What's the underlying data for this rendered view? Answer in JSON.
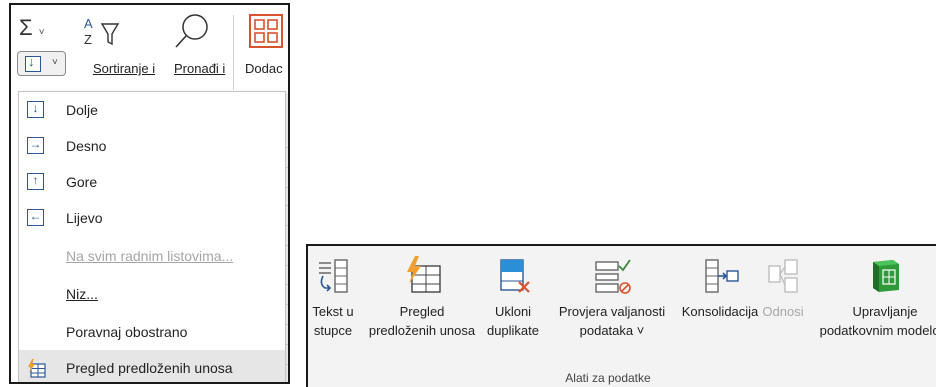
{
  "ribbon_top": {
    "sigma": "Σ",
    "sort_label": "Sortiranje i",
    "find_label": "Pronađi i",
    "add_label": "Dodac",
    "partial_text": "c"
  },
  "fill_menu": {
    "items": [
      {
        "label": "Dolje",
        "icon": "arrow-down-icon",
        "glyph": "↓",
        "disabled": false
      },
      {
        "label": "Desno",
        "icon": "arrow-right-icon",
        "glyph": "→",
        "disabled": false
      },
      {
        "label": "Gore",
        "icon": "arrow-up-icon",
        "glyph": "↑",
        "disabled": false
      },
      {
        "label": "Lijevo",
        "icon": "arrow-left-icon",
        "glyph": "←",
        "disabled": false
      },
      {
        "label": "Na svim radnim listovima...",
        "disabled": true
      },
      {
        "label": "Niz...",
        "disabled": false
      },
      {
        "label": "Poravnaj obostrano",
        "disabled": false
      },
      {
        "label": "Pregled predloženih unosa",
        "icon": "flash-fill-icon",
        "disabled": false,
        "selected": true
      }
    ]
  },
  "data_tools": {
    "buttons": [
      {
        "line1": "Tekst u",
        "line2": "stupce",
        "icon": "text-to-columns-icon"
      },
      {
        "line1": "Pregled",
        "line2": "predloženih unosa",
        "icon": "flash-fill-icon"
      },
      {
        "line1": "Ukloni",
        "line2": "duplikate",
        "icon": "remove-duplicates-icon"
      },
      {
        "line1": "Provjera valjanosti",
        "line2": "podataka ˅",
        "icon": "data-validation-icon"
      },
      {
        "line1": "Konsolidacija",
        "line2": "",
        "icon": "consolidate-icon"
      },
      {
        "line1": "Odnosi",
        "line2": "",
        "icon": "relationships-icon",
        "disabled": true
      },
      {
        "line1": "Upravljanje",
        "line2": "podatkovnim modelom",
        "icon": "data-model-icon"
      }
    ],
    "group_label": "Alati za podatke"
  },
  "colors": {
    "accent_blue": "#2b5797",
    "flash_fill_orange": "#f0a030",
    "green": "#3a8a3a",
    "orange_red": "#d9532c",
    "disabled_gray": "#a6a6a6",
    "selected_bg": "#e6e6e6"
  }
}
